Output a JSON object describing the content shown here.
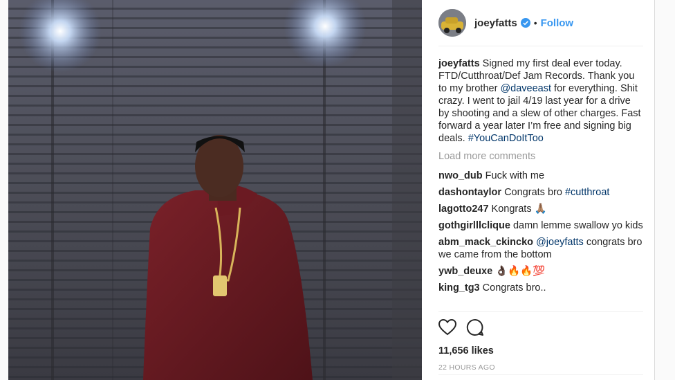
{
  "post": {
    "username": "joeyfatts",
    "follow_label": "Follow",
    "separator": "•",
    "caption": {
      "user": "joeyfatts",
      "text_1": " Signed my first deal ever today. FTD/Cutthroat/Def Jam Records. Thank you to my brother ",
      "mention": "@daveeast",
      "text_2": " for everything. Shit crazy. I went to jail 4/19 last year for a drive by shooting and a slew of other charges. Fast forward a year later I’m free and signing big deals. ",
      "hashtag": "#YouCanDoItToo"
    },
    "load_more": "Load more comments",
    "comments": [
      {
        "user": "nwo_dub",
        "text": "Fuck with me",
        "link": ""
      },
      {
        "user": "dashontaylor",
        "text": "Congrats bro ",
        "link": "#cutthroat"
      },
      {
        "user": "lagotto247",
        "text": "Kongrats 🙏🏽",
        "link": ""
      },
      {
        "user": "gothgirlllclique",
        "text": "damn lemme swallow yo kids",
        "link": ""
      },
      {
        "user": "abm_mack_ckincko",
        "text": " congrats bro we came from the bottom",
        "link": "@joeyfatts"
      },
      {
        "user": "ywb_deuxe",
        "text": "👌🏿🔥🔥💯",
        "link": ""
      },
      {
        "user": "king_tg3",
        "text": "Congrats bro..",
        "link": ""
      }
    ],
    "likes": "11,656 likes",
    "time": "22 HOURS AGO",
    "colors": {
      "link": "#003569",
      "follow": "#3897f0",
      "verified": "#3897f0"
    },
    "icons": [
      "heart-icon",
      "comment-icon",
      "verified-icon"
    ]
  }
}
